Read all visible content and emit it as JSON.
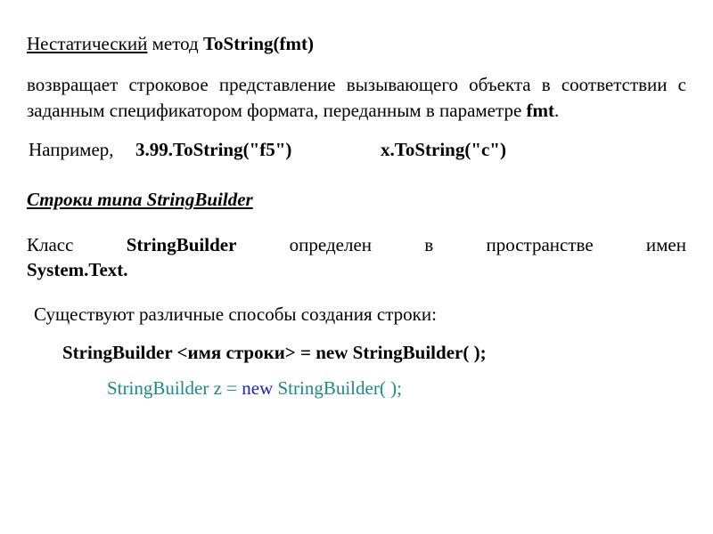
{
  "heading": {
    "prefix_underlined": "Нестатический",
    "rest": " метод ",
    "method_bold": "ToString(fmt)"
  },
  "para1": {
    "text_before": "возвращает строковое представление вызывающего объекта в соответствии с заданным спецификатором формата, переданным в параметре ",
    "param_bold": "fmt",
    "dot": "."
  },
  "example": {
    "label": "Например,",
    "a": "3.99.ToString(\"f5\")",
    "b": "x.ToString(\"c\")"
  },
  "section_heading": "Строки типа StringBuilder",
  "para2": {
    "w1": "Класс",
    "w2_bold": "StringBuilder",
    "w3": "определен",
    "w4": "в",
    "w5": "пространстве",
    "w6": "имен",
    "line2_bold": "System.Text."
  },
  "para3": "Существуют различные способы создания строки:",
  "syntax": "StringBuilder <имя строки> = new StringBuilder( );",
  "code": {
    "p1": "StringBuilder z = ",
    "kw": "new",
    "p2": " StringBuilder( );"
  }
}
